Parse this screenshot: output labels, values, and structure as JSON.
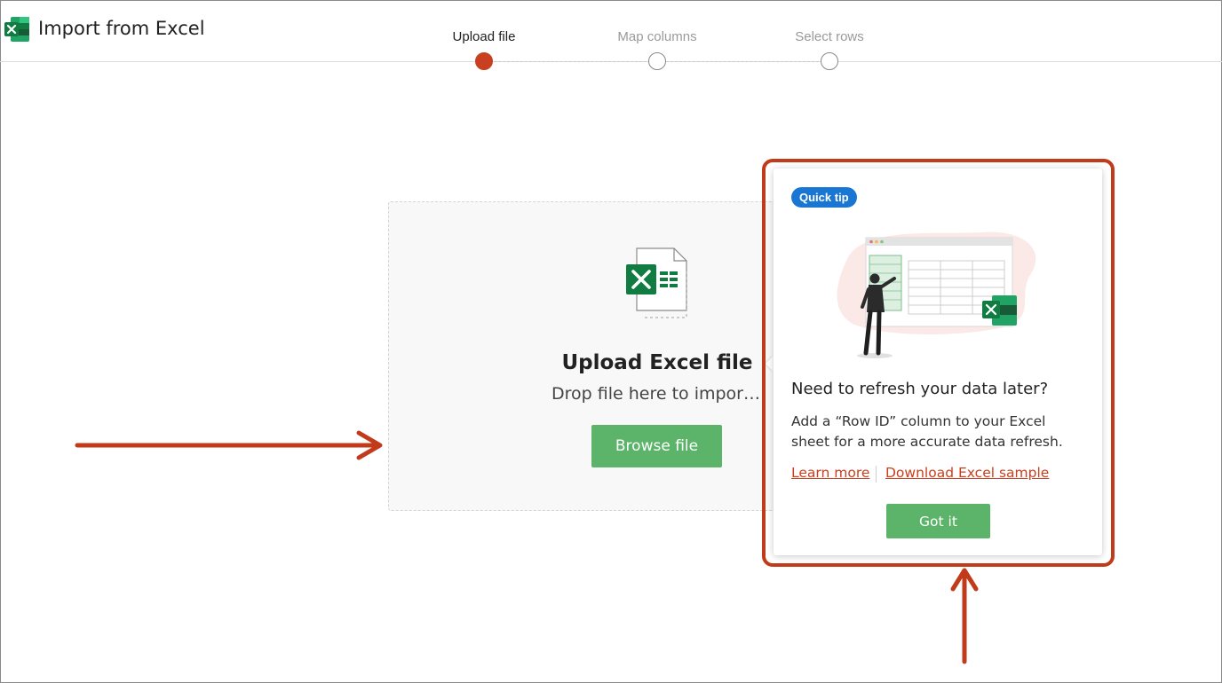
{
  "header": {
    "title": "Import from Excel",
    "logo_icon": "excel-logo-icon"
  },
  "stepper": {
    "steps": [
      {
        "label": "Upload file",
        "state": "active"
      },
      {
        "label": "Map columns",
        "state": "inactive"
      },
      {
        "label": "Select rows",
        "state": "inactive"
      }
    ],
    "active_color": "#c8401f"
  },
  "upload": {
    "file_icon": "excel-file-icon",
    "title": "Upload Excel file",
    "subtitle": "Drop file here to import or...",
    "browse_label": "Browse file",
    "button_color": "#5cb46a"
  },
  "tip": {
    "badge": "Quick tip",
    "badge_color": "#1976d2",
    "illustration": "spreadsheet-illustration",
    "title": "Need to refresh your data later?",
    "body": "Add a “Row ID” column to your Excel sheet for a more accurate data refresh.",
    "learn_more": "Learn more",
    "download_sample": "Download Excel sample",
    "link_color": "#c8401f",
    "got_it": "Got it"
  },
  "annotations": {
    "color": "#c13b1b",
    "arrows": [
      "arrow-right-icon",
      "arrow-up-icon"
    ],
    "highlight": "tip-highlight-box"
  }
}
